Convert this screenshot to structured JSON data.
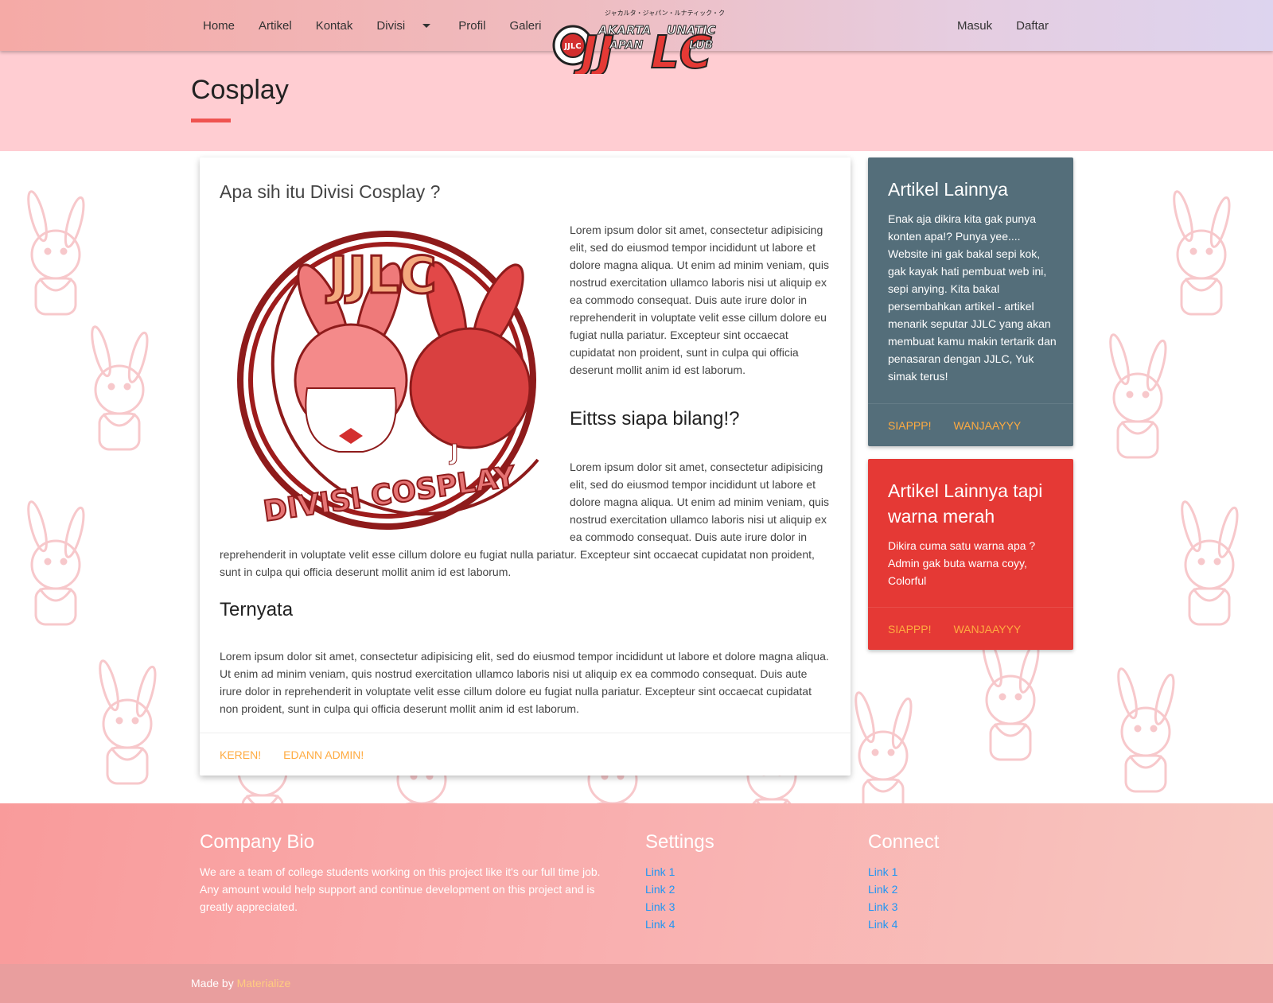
{
  "nav": {
    "home": "Home",
    "artikel": "Artikel",
    "kontak": "Kontak",
    "divisi": "Divisi",
    "profil": "Profil",
    "galeri": "Galeri",
    "masuk": "Masuk",
    "daftar": "Daftar"
  },
  "logo": {
    "katakana": "ジャカルタ・ジャパン・ルナティック・クラブ",
    "line1": "AKARTA",
    "line2": "APAN",
    "line3": "UNATIC",
    "line4": "LUB",
    "big1": "JJ",
    "big2": "LC",
    "ring": "JAKARTA JAPAN LUNATIC"
  },
  "hero": {
    "title": "Cosplay"
  },
  "main": {
    "title": "Apa sih itu Divisi Cosplay ?",
    "badge_top": "JJLC",
    "badge_bottom": "DIVISI COSPLAY",
    "badge_j": "J",
    "para1": "Lorem ipsum dolor sit amet, consectetur adipisicing elit, sed do eiusmod tempor incididunt ut labore et dolore magna aliqua. Ut enim ad minim veniam, quis nostrud exercitation ullamco laboris nisi ut aliquip ex ea commodo consequat. Duis aute irure dolor in reprehenderit in voluptate velit esse cillum dolore eu fugiat nulla pariatur. Excepteur sint occaecat cupidatat non proident, sunt in culpa qui officia deserunt mollit anim id est laborum.",
    "heading2": "Eittss siapa bilang!?",
    "para2": "Lorem ipsum dolor sit amet, consectetur adipisicing elit, sed do eiusmod tempor incididunt ut labore et dolore magna aliqua. Ut enim ad minim veniam, quis nostrud exercitation ullamco laboris nisi ut aliquip ex ea commodo consequat. Duis aute irure dolor in reprehenderit in voluptate velit esse cillum dolore eu fugiat nulla pariatur. Excepteur sint occaecat cupidatat non proident, sunt in culpa qui officia deserunt mollit anim id est laborum.",
    "heading3": "Ternyata",
    "para3": "Lorem ipsum dolor sit amet, consectetur adipisicing elit, sed do eiusmod tempor incididunt ut labore et dolore magna aliqua. Ut enim ad minim veniam, quis nostrud exercitation ullamco laboris nisi ut aliquip ex ea commodo consequat. Duis aute irure dolor in reprehenderit in voluptate velit esse cillum dolore eu fugiat nulla pariatur. Excepteur sint occaecat cupidatat non proident, sunt in culpa qui officia deserunt mollit anim id est laborum.",
    "action1": "KEREN!",
    "action2": "EDANN ADMIN!"
  },
  "side1": {
    "title": "Artikel Lainnya",
    "text": "Enak aja dikira kita gak punya konten apa!? Punya yee.... Website ini gak bakal sepi kok, gak kayak hati pembuat web ini, sepi anying. Kita bakal persembahkan artikel - artikel menarik seputar JJLC yang akan membuat kamu makin tertarik dan penasaran dengan JJLC, Yuk simak terus!",
    "action1": "SIAPPP!",
    "action2": "WANJAAYYY"
  },
  "side2": {
    "title": "Artikel Lainnya tapi warna merah",
    "text": "Dikira cuma satu warna apa ? Admin gak buta warna coyy, Colorful",
    "action1": "SIAPPP!",
    "action2": "WANJAAYYY"
  },
  "footer": {
    "bio_title": "Company Bio",
    "bio_text": "We are a team of college students working on this project like it's our full time job. Any amount would help support and continue development on this project and is greatly appreciated.",
    "settings_title": "Settings",
    "connect_title": "Connect",
    "settings_links": [
      "Link 1",
      "Link 2",
      "Link 3",
      "Link 4"
    ],
    "connect_links": [
      "Link 1",
      "Link 2",
      "Link 3",
      "Link 4"
    ],
    "made_by": "Made by",
    "made_by_link": "Materialize"
  },
  "colors": {
    "accent_orange": "#ffab40",
    "hero_pink": "#ffcdd2",
    "underline_red": "#ef5350",
    "card_grey": "#546e7a",
    "card_red": "#e53935",
    "link_blue": "#2196f3"
  }
}
